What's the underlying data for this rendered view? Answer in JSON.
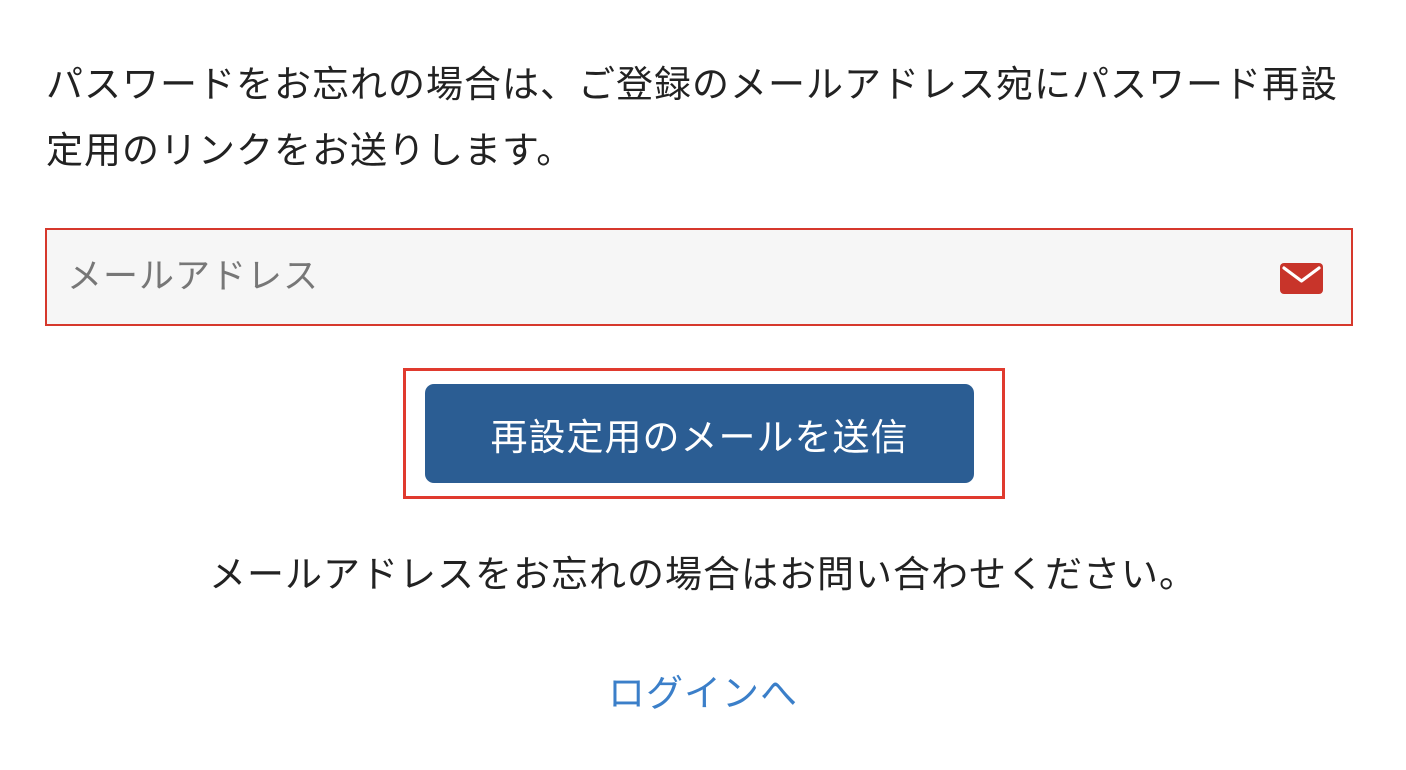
{
  "intro": {
    "text": "パスワードをお忘れの場合は、ご登録のメールアドレス宛にパスワード再設定用のリンクをお送りします。"
  },
  "email": {
    "placeholder": "メールアドレス",
    "value": "",
    "icon": "envelope-icon",
    "icon_color": "#c8342a",
    "border_color": "#d6382c"
  },
  "submit": {
    "label": "再設定用のメールを送信",
    "color": "#2b5d93"
  },
  "help": {
    "forgot_email_text": "メールアドレスをお忘れの場合はお問い合わせください。"
  },
  "nav": {
    "login_label": "ログインへ",
    "link_color": "#3b7fc9"
  }
}
